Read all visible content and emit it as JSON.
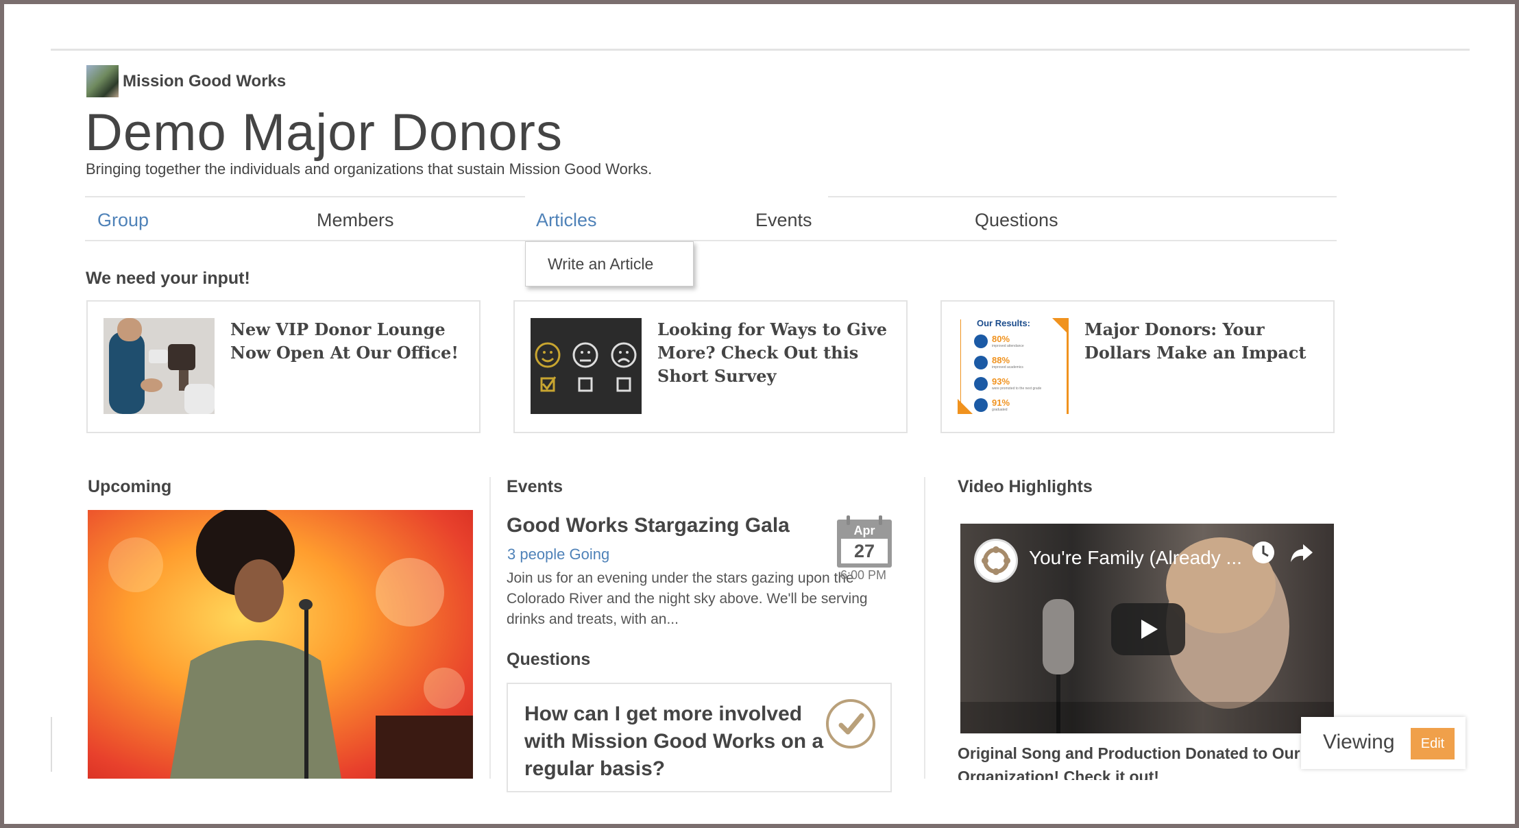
{
  "org": {
    "name": "Mission Good Works"
  },
  "page": {
    "title": "Demo Major Donors",
    "subtitle": "Bringing together the individuals and organizations that sustain Mission Good Works."
  },
  "nav": {
    "tabs": [
      {
        "label": "Group",
        "active": true
      },
      {
        "label": "Members",
        "active": false
      },
      {
        "label": "Articles",
        "active": true
      },
      {
        "label": "Events",
        "active": false
      },
      {
        "label": "Questions",
        "active": false
      }
    ],
    "dropdown": {
      "item": "Write an Article"
    }
  },
  "input_section": {
    "title": "We need your input!",
    "cards": [
      {
        "title": "New VIP Donor Lounge Now Open At Our Office!"
      },
      {
        "title": "Looking for Ways to Give More? Check Out this Short Survey"
      },
      {
        "title": "Major Donors: Your Dollars Make an Impact"
      }
    ]
  },
  "results_thumb": {
    "heading": "Our Results:",
    "stats": [
      {
        "value": "80%",
        "label": "improved attendance"
      },
      {
        "value": "88%",
        "label": "improved academics"
      },
      {
        "value": "93%",
        "label": "were promoted to the next grade"
      },
      {
        "value": "91%",
        "label": "graduated"
      }
    ]
  },
  "upcoming": {
    "title": "Upcoming"
  },
  "events": {
    "title": "Events",
    "event": {
      "name": "Good Works Stargazing Gala",
      "going": "3 people Going",
      "description": "Join us for an evening under the stars gazing upon the Colorado River and the night sky above. We'll be serving drinks and treats, with an...",
      "month": "Apr",
      "day": "27",
      "time": "6:00 PM"
    }
  },
  "questions": {
    "title": "Questions",
    "question": "How can I get more involved with Mission Good Works on a regular basis?"
  },
  "video": {
    "title": "Video Highlights",
    "video_title": "You're Family (Already ...",
    "caption": "Original Song and Production Donated to Our Organization! Check it out!"
  },
  "viewing": {
    "label": "Viewing",
    "edit_label": "Edit"
  },
  "colors": {
    "accent": "#4f82b8",
    "edit": "#f0a04a",
    "results_orange": "#f0921e"
  }
}
